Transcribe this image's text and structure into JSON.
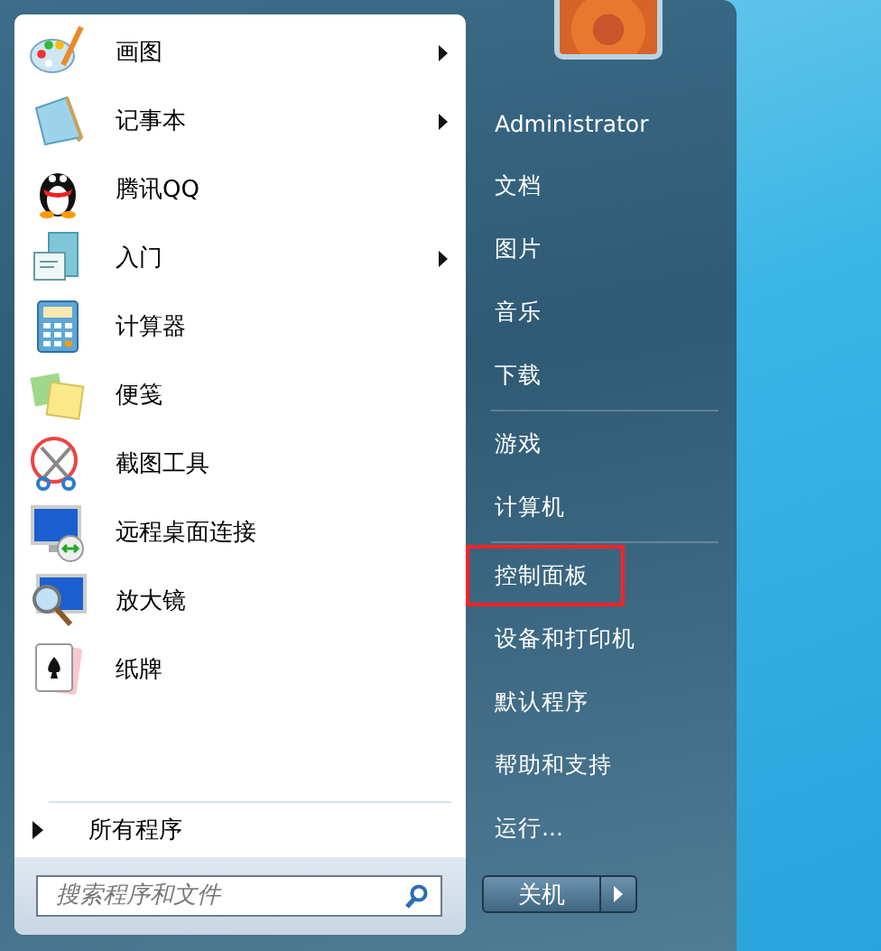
{
  "programs": [
    {
      "label": "画图",
      "has_submenu": true
    },
    {
      "label": "记事本",
      "has_submenu": true
    },
    {
      "label": "腾讯QQ",
      "has_submenu": false
    },
    {
      "label": "入门",
      "has_submenu": true
    },
    {
      "label": "计算器",
      "has_submenu": false
    },
    {
      "label": "便笺",
      "has_submenu": false
    },
    {
      "label": "截图工具",
      "has_submenu": false
    },
    {
      "label": "远程桌面连接",
      "has_submenu": false
    },
    {
      "label": "放大镜",
      "has_submenu": false
    },
    {
      "label": "纸牌",
      "has_submenu": false
    }
  ],
  "all_programs": "所有程序",
  "search": {
    "placeholder": "搜索程序和文件"
  },
  "right_panel": {
    "groups": [
      {
        "items": [
          {
            "label": "Administrator",
            "highlighted": false
          },
          {
            "label": "文档",
            "highlighted": false
          },
          {
            "label": "图片",
            "highlighted": false
          },
          {
            "label": "音乐",
            "highlighted": false
          },
          {
            "label": "下载",
            "highlighted": false
          }
        ]
      },
      {
        "items": [
          {
            "label": "游戏",
            "highlighted": false
          },
          {
            "label": "计算机",
            "highlighted": false
          }
        ]
      },
      {
        "items": [
          {
            "label": "控制面板",
            "highlighted": true
          },
          {
            "label": "设备和打印机",
            "highlighted": false
          },
          {
            "label": "默认程序",
            "highlighted": false
          },
          {
            "label": "帮助和支持",
            "highlighted": false
          },
          {
            "label": "运行...",
            "highlighted": false
          }
        ]
      }
    ]
  },
  "shutdown": {
    "label": "关机"
  }
}
